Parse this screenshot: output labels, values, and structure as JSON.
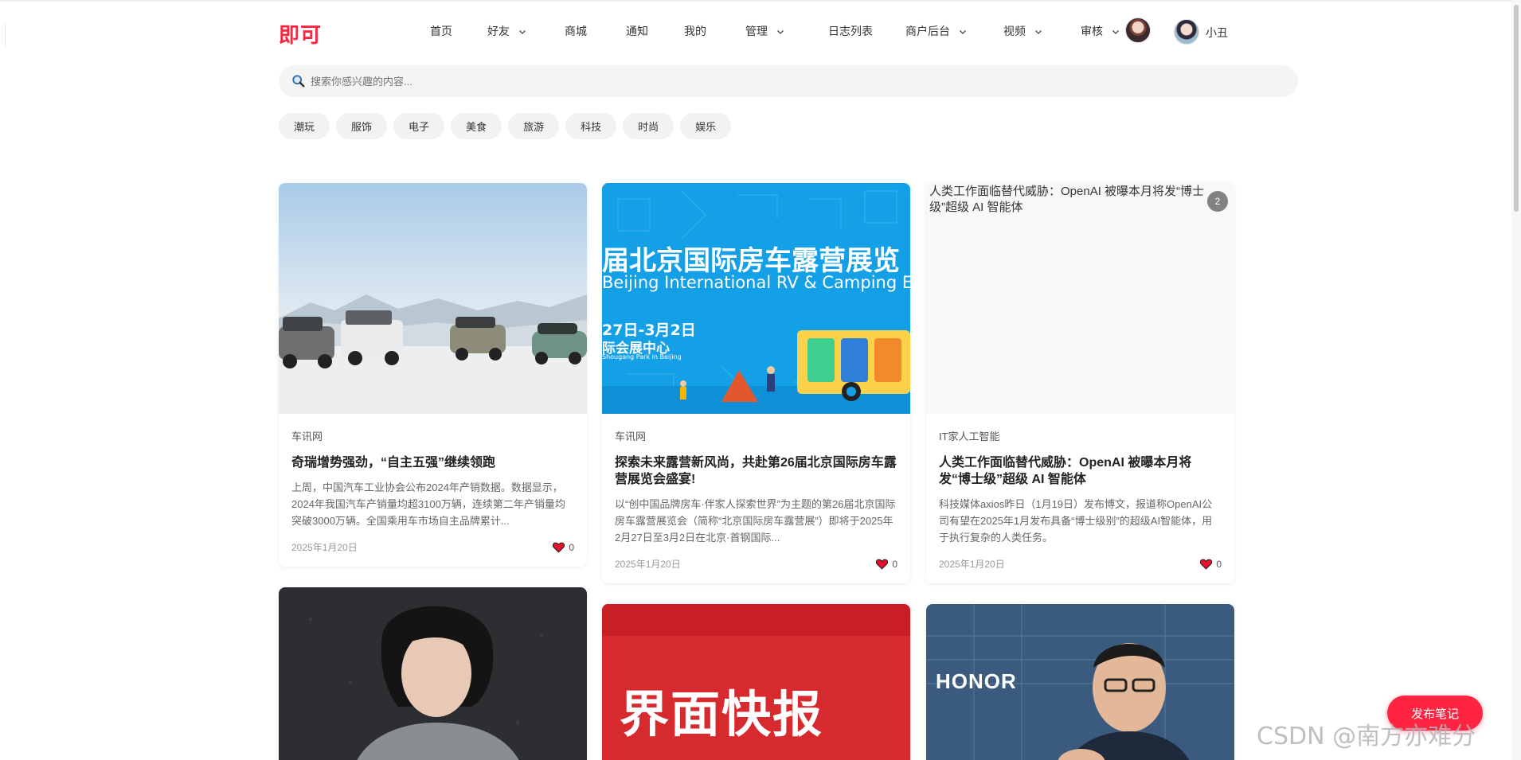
{
  "brand": {
    "logo": "即可",
    "accent": "#ff2442"
  },
  "nav": {
    "items": [
      {
        "label": "首页",
        "dropdown": false
      },
      {
        "label": "好友",
        "dropdown": true
      },
      {
        "label": "商城",
        "dropdown": false
      },
      {
        "label": "通知",
        "dropdown": false
      },
      {
        "label": "我的",
        "dropdown": false
      },
      {
        "label": "管理",
        "dropdown": true
      },
      {
        "label": "日志列表",
        "dropdown": false
      },
      {
        "label": "商户后台",
        "dropdown": true
      },
      {
        "label": "视频",
        "dropdown": true
      },
      {
        "label": "审核",
        "dropdown": true
      }
    ],
    "username": "小丑"
  },
  "search": {
    "placeholder": "搜索你感兴趣的内容..."
  },
  "categories": [
    "潮玩",
    "服饰",
    "电子",
    "美食",
    "旅游",
    "科技",
    "时尚",
    "娱乐"
  ],
  "cards": [
    {
      "source": "车讯网",
      "title": "奇瑞增势强劲，“自主五强”继续领跑",
      "desc": "上周，中国汽车工业协会公布2024年产销数据。数据显示，2024年我国汽车产销量均超3100万辆，连续第二年产销量均突破3000万辆。全国乘用车市场自主品牌累计...",
      "date": "2025年1月20日",
      "likes": "0"
    },
    {
      "source": "车讯网",
      "title": "探索未来露营新风尚，共赴第26届北京国际房车露营展览会盛宴!",
      "desc": "以“创中国品牌房车·伴家人探索世界”为主题的第26届北京国际房车露营展览会（简称“北京国际房车露营展”）即将于2025年2月27日至3月2日在北京·首钢国际...",
      "date": "2025年1月20日",
      "likes": "0",
      "banner": {
        "line1": "届北京国际房车露营展览",
        "line2": "Beijing International RV & Camping Exh",
        "line3": "27日-3月2日",
        "line4": "际会展中心",
        "line5": "Shougang Park in Beijing"
      }
    },
    {
      "source": "IT家人工智能",
      "title": "人类工作面临替代威胁：OpenAI 被曝本月将发“博士级”超级 AI 智能体",
      "desc": "科技媒体axios昨日（1月19日）发布博文，报道称OpenAI公司有望在2025年1月发布具备“博士级别”的超级AI智能体，用于执行复杂的人类任务。",
      "date": "2025年1月20日",
      "likes": "0",
      "alt": "人类工作面临替代威胁：OpenAI 被曝本月将发“博士级”超级 AI 智能体",
      "badge": "2"
    }
  ],
  "row2": {
    "jiemian": "界面快报",
    "honor": "HONOR"
  },
  "publish_label": "发布笔记",
  "watermark": "CSDN @南方亦难分"
}
